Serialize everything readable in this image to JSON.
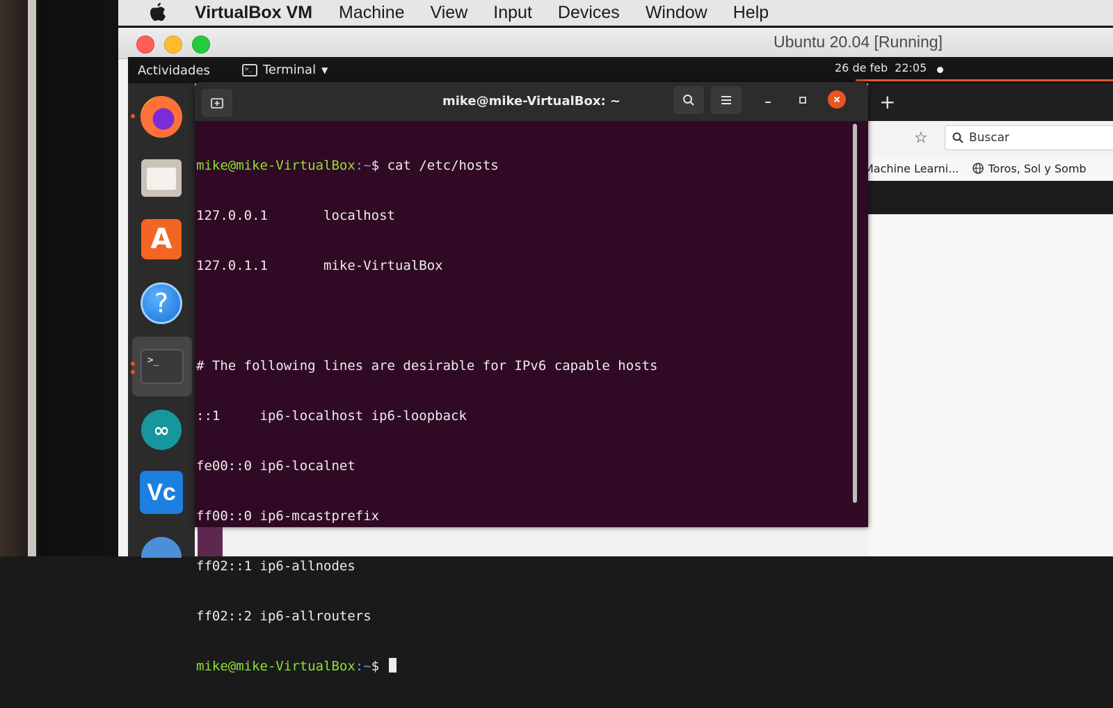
{
  "mac_menubar": {
    "app_name": "VirtualBox VM",
    "items": [
      "Machine",
      "View",
      "Input",
      "Devices",
      "Window",
      "Help"
    ]
  },
  "vbox_window": {
    "title": "Ubuntu 20.04 [Running]"
  },
  "ubuntu_topbar": {
    "activities": "Actividades",
    "app_menu": "Terminal",
    "date": "26 de feb",
    "time": "22:05"
  },
  "dock": {
    "items": [
      "firefox-icon",
      "files-icon",
      "software-icon",
      "help-icon",
      "terminal-icon",
      "arduino-icon",
      "vnc-icon"
    ],
    "help_glyph": "?",
    "software_glyph": "A",
    "terminal_glyph": ">_",
    "arduino_glyph": "∞",
    "vnc_glyph": "Vc"
  },
  "terminal": {
    "title": "mike@mike-VirtualBox: ~",
    "prompt_user": "mike@mike-VirtualBox",
    "prompt_path": ":~",
    "prompt_sym": "$",
    "command": " cat /etc/hosts",
    "output": [
      "127.0.0.1       localhost",
      "127.0.1.1       mike-VirtualBox",
      "",
      "# The following lines are desirable for IPv6 capable hosts",
      "::1     ip6-localhost ip6-loopback",
      "fe00::0 ip6-localnet",
      "ff00::0 ip6-mcastprefix",
      "ff02::1 ip6-allnodes",
      "ff02::2 ip6-allrouters"
    ]
  },
  "firefox": {
    "new_tab": "+",
    "search_placeholder": "Buscar",
    "bookmarks": [
      "Machine Learni...",
      "Toros, Sol y Somb"
    ]
  },
  "colors": {
    "terminal_bg": "#300a24",
    "prompt_user": "#8ae234",
    "prompt_path": "#729fcf",
    "ubuntu_orange": "#e95420"
  }
}
